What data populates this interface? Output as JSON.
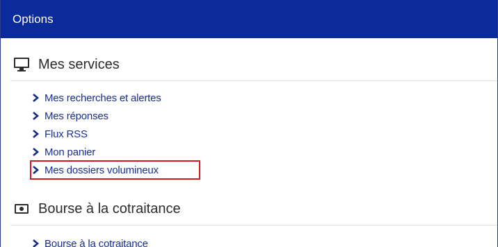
{
  "header": {
    "title": "Options"
  },
  "sections": [
    {
      "title": "Mes services",
      "icon": "monitor-icon",
      "items": [
        {
          "label": "Mes recherches et alertes"
        },
        {
          "label": "Mes réponses"
        },
        {
          "label": "Flux RSS"
        },
        {
          "label": "Mon panier"
        },
        {
          "label": "Mes dossiers volumineux",
          "highlighted": true
        }
      ]
    },
    {
      "title": "Bourse à la cotraitance",
      "icon": "banknote-icon",
      "items": [
        {
          "label": "Bourse à la cotraitance"
        }
      ]
    }
  ],
  "colors": {
    "header_bg": "#0b2b9d",
    "link": "#1b2f8f",
    "highlight_border": "#d9141e"
  }
}
